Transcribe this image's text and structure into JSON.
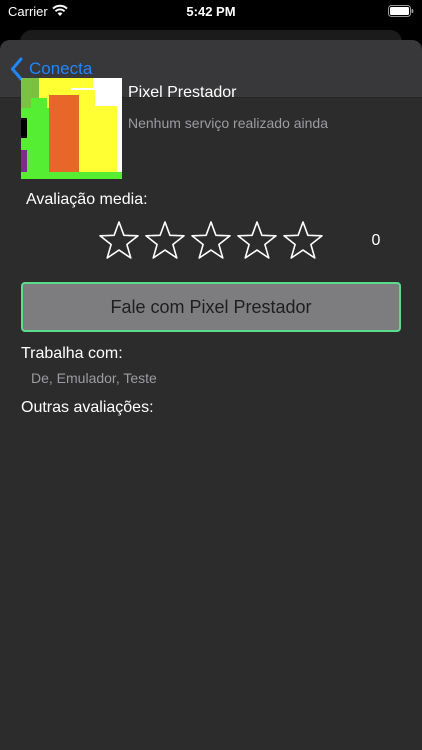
{
  "status_bar": {
    "carrier": "Carrier",
    "time": "5:42 PM"
  },
  "nav": {
    "back_label": "Conecta"
  },
  "provider": {
    "name": "Pixel Prestador",
    "service_status": "Nenhum serviço realizado ainda"
  },
  "rating": {
    "label": "Avaliação media:",
    "stars_filled": 0,
    "stars_total": 5,
    "count": "0"
  },
  "contact_button": {
    "label": "Fale com Pixel Prestador"
  },
  "works_with": {
    "label": "Trabalha com:",
    "value": "De, Emulador, Teste"
  },
  "other_reviews": {
    "label": "Outras avaliações:"
  },
  "colors": {
    "accent": "#1f86ff",
    "button_border": "#5ddb8c",
    "background": "#2c2c2d"
  }
}
